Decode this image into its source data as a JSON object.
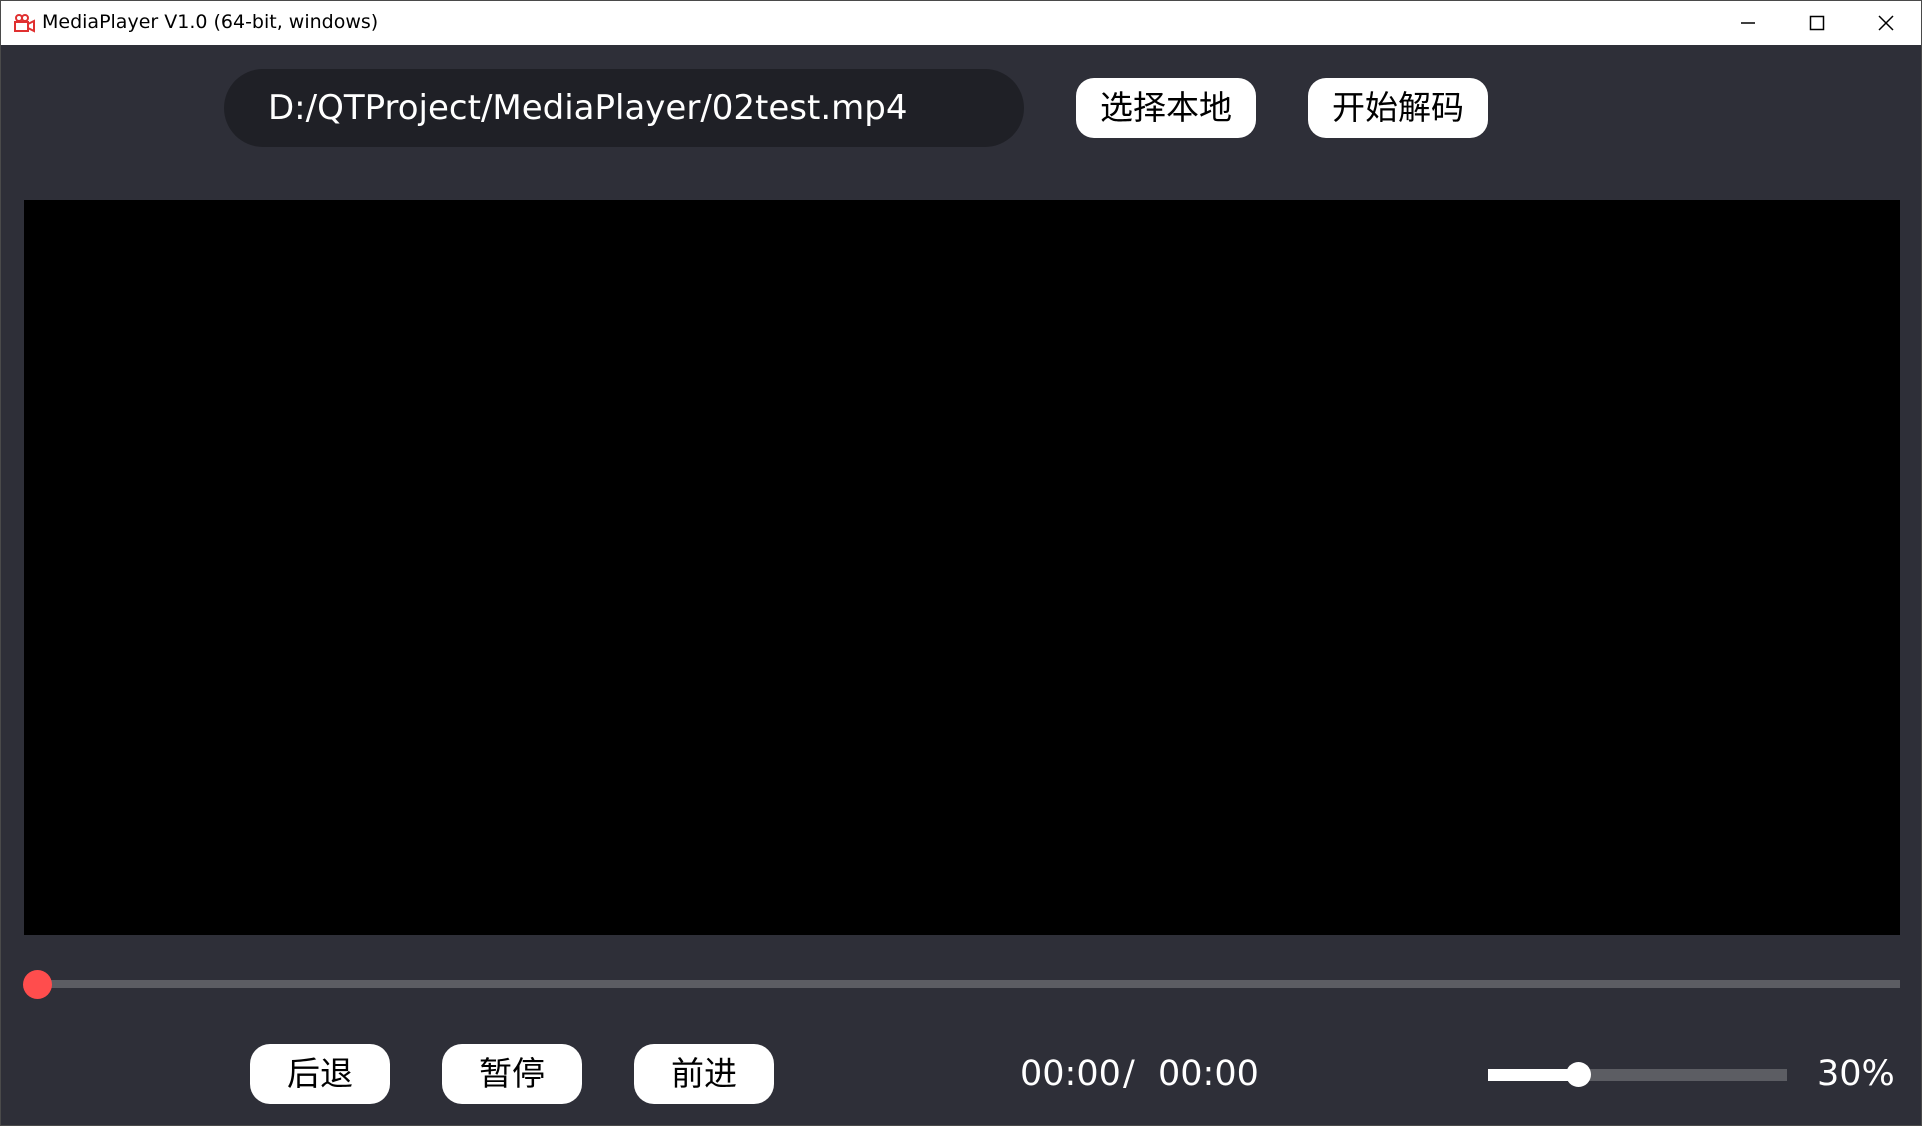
{
  "window": {
    "title": "MediaPlayer V1.0 (64-bit, windows)",
    "icon": "media-player-app-icon"
  },
  "top_bar": {
    "file_path": "D:/QTProject/MediaPlayer/02test.mp4",
    "choose_local_label": "选择本地",
    "start_decode_label": "开始解码"
  },
  "playback": {
    "progress_fraction": 0.0,
    "progress_color": "#ff4d4d",
    "back_label": "后退",
    "pause_label": "暂停",
    "forward_label": "前进",
    "time_current": "00:00",
    "time_separator": "/",
    "time_total": "00:00"
  },
  "volume": {
    "level_percent": 30,
    "label": "30%"
  },
  "colors": {
    "background": "#2e2f38",
    "path_box": "#1f2026",
    "video": "#000000",
    "track": "#5c5d63",
    "button": "#ffffff"
  }
}
